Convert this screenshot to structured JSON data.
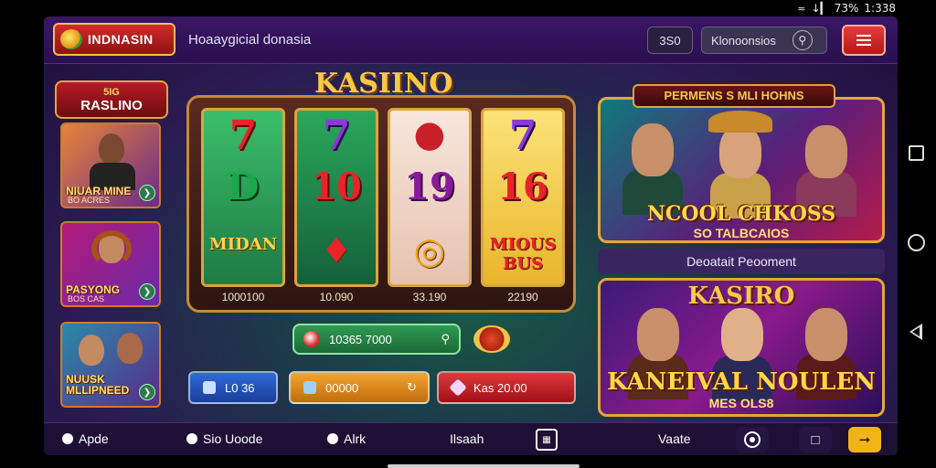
{
  "status_bar": {
    "signal_text": "↓▎",
    "battery": "73%",
    "time": "1:338"
  },
  "header": {
    "logo_text": "INDNASIN",
    "site_title": "Hoaaygicial donasia",
    "balance": "3S0",
    "search_label": "Klonoonsios",
    "search_icon": "search-icon",
    "menu_icon": "hamburger-icon"
  },
  "sidebar": {
    "badge_line1": "5IG",
    "badge_line2": "RASLINO",
    "cards": [
      {
        "title": "NIUAR MINE",
        "subtitle": "BO ACRES"
      },
      {
        "title": "PASYONG",
        "subtitle": "BOS CAS"
      },
      {
        "title": "NUUSK MLLIPNEED",
        "subtitle": ""
      }
    ]
  },
  "slot": {
    "title": "KASIINO",
    "reels": [
      {
        "top": "7",
        "mid": "D",
        "bottom": "MIDAN",
        "value": "1000100",
        "bg": "#2f9a5a"
      },
      {
        "top": "7",
        "mid": "10",
        "bottom": "♦",
        "value": "10.090",
        "bg": "#1f7a42"
      },
      {
        "top": "●",
        "mid": "19",
        "bottom": "◎",
        "value": "33.190",
        "bg": "#f2d6c6"
      },
      {
        "top": "7",
        "mid": "16",
        "bottom": "MIOUS BUS",
        "value": "22190",
        "bg": "#f4d04a"
      }
    ],
    "bar_value": "10365 7000"
  },
  "actions": {
    "blue_label": "L0 36",
    "orange_label": "00000",
    "red_label": "Kas 20.00"
  },
  "promos": {
    "ribbon": "PERMENS S MLI HOHNS",
    "card1_big": "NCOOL CHKOSS",
    "card1_sub": "SO TALBCAIOS",
    "label": "Deoatait Peooment",
    "card2_title": "KASIRO",
    "card2_big": "KANEIVAL NOULEN",
    "card2_sub": "MES OLS8"
  },
  "footer": {
    "items": [
      "Apde",
      "Sio Uoode",
      "Alrk",
      "Ilsaah",
      "Vaate"
    ],
    "colors": {
      "gold": "#f0b419"
    }
  }
}
